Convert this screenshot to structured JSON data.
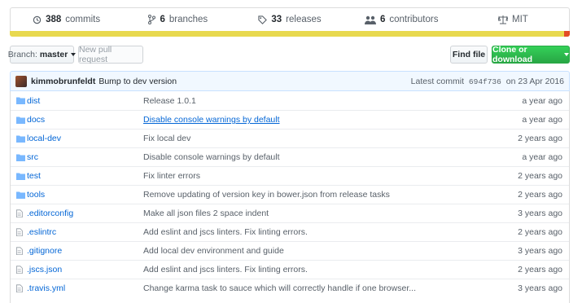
{
  "summary": {
    "commits": {
      "count": "388",
      "label": "commits",
      "icon": "history-icon"
    },
    "branches": {
      "count": "6",
      "label": "branches",
      "icon": "branch-icon"
    },
    "releases": {
      "count": "33",
      "label": "releases",
      "icon": "tag-icon"
    },
    "contributors": {
      "count": "6",
      "label": "contributors",
      "icon": "people-icon"
    },
    "license": {
      "label": "MIT",
      "icon": "law-icon"
    }
  },
  "language_colors": {
    "primary": "#e8d94f",
    "secondary": "#e34c26"
  },
  "toolbar": {
    "branch_prefix": "Branch:",
    "branch_name": "master",
    "new_pull_request": "New pull request",
    "find_file": "Find file",
    "clone_or_download": "Clone or download"
  },
  "latest_commit": {
    "author": "kimmobrunfeldt",
    "message": "Bump to dev version",
    "prefix": "Latest commit",
    "sha": "694f736",
    "date": "on 23 Apr 2016"
  },
  "files": [
    {
      "name": "dist",
      "type": "dir",
      "message": "Release 1.0.1",
      "age": "a year ago"
    },
    {
      "name": "docs",
      "type": "dir",
      "message": "Disable console warnings by default",
      "age": "a year ago",
      "link": true
    },
    {
      "name": "local-dev",
      "type": "dir",
      "message": "Fix local dev",
      "age": "2 years ago"
    },
    {
      "name": "src",
      "type": "dir",
      "message": "Disable console warnings by default",
      "age": "a year ago"
    },
    {
      "name": "test",
      "type": "dir",
      "message": "Fix linter errors",
      "age": "2 years ago"
    },
    {
      "name": "tools",
      "type": "dir",
      "message": "Remove updating of version key in bower.json from release tasks",
      "age": "2 years ago"
    },
    {
      "name": ".editorconfig",
      "type": "file",
      "message": "Make all json files 2 space indent",
      "age": "3 years ago"
    },
    {
      "name": ".eslintrc",
      "type": "file",
      "message": "Add eslint and jscs linters. Fix linting errors.",
      "age": "2 years ago"
    },
    {
      "name": ".gitignore",
      "type": "file",
      "message": "Add local dev environment and guide",
      "age": "3 years ago"
    },
    {
      "name": ".jscs.json",
      "type": "file",
      "message": "Add eslint and jscs linters. Fix linting errors.",
      "age": "2 years ago"
    },
    {
      "name": ".travis.yml",
      "type": "file",
      "message": "Change karma task to sauce which will correctly handle if one browser...",
      "age": "3 years ago"
    }
  ]
}
